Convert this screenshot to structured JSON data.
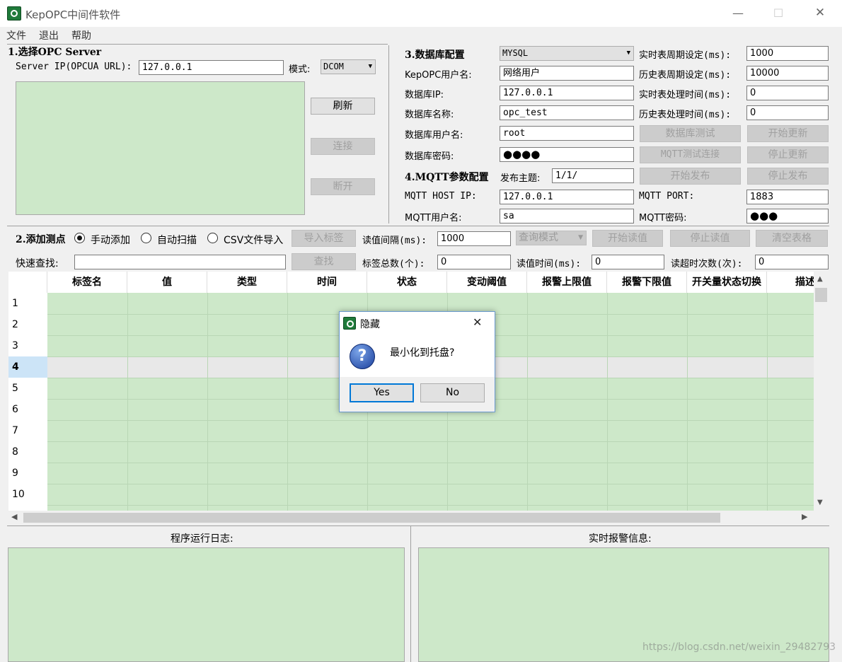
{
  "window": {
    "title": "KepOPC中间件软件",
    "min": "—",
    "max": "☐",
    "close": "✕"
  },
  "menu": [
    "文件",
    "退出",
    "帮助"
  ],
  "opc": {
    "title": "1.选择OPC Server",
    "ip_label": "Server IP(OPCUA URL):",
    "ip_value": "127.0.0.1",
    "mode_label": "模式:",
    "mode_value": "DCOM",
    "refresh": "刷新",
    "connect": "连接",
    "disconnect": "断开"
  },
  "db": {
    "title": "3.数据库配置",
    "db_type": "MYSQL",
    "user_label": "KepOPC用户名:",
    "user_value": "网络用户",
    "ip_label": "数据库IP:",
    "ip_value": "127.0.0.1",
    "name_label": "数据库名称:",
    "name_value": "opc_test",
    "dbuser_label": "数据库用户名:",
    "dbuser_value": "root",
    "pwd_label": "数据库密码:",
    "pwd_value": "●●●●",
    "rt_period_label": "实时表周期设定(ms):",
    "rt_period_value": "1000",
    "hist_period_label": "历史表周期设定(ms):",
    "hist_period_value": "10000",
    "rt_proc_label": "实时表处理时间(ms):",
    "rt_proc_value": "0",
    "hist_proc_label": "历史表处理时间(ms):",
    "hist_proc_value": "0",
    "db_test": "数据库测试",
    "start_update": "开始更新",
    "mqtt_test": "MQTT测试连接",
    "stop_update": "停止更新"
  },
  "mqtt": {
    "title": "4.MQTT参数配置",
    "topic_label": "发布主题:",
    "topic_value": "1/1/",
    "start_pub": "开始发布",
    "stop_pub": "停止发布",
    "host_label": "MQTT HOST IP:",
    "host_value": "127.0.0.1",
    "port_label": "MQTT PORT:",
    "port_value": "1883",
    "user_label": "MQTT用户名:",
    "user_value": "sa",
    "pwd_label": "MQTT密码:",
    "pwd_value": "●●●"
  },
  "points": {
    "title": "2.添加测点",
    "manual": "手动添加",
    "auto": "自动扫描",
    "csv": "CSV文件导入",
    "import": "导入标签",
    "interval_label": "读值间隔(ms):",
    "interval_value": "1000",
    "query_mode": "查询模式",
    "start_read": "开始读值",
    "stop_read": "停止读值",
    "clear": "清空表格",
    "search_label": "快速查找:",
    "search_value": "",
    "search_btn": "查找",
    "total_label": "标签总数(个):",
    "total_value": "0",
    "readtime_label": "读值时间(ms):",
    "readtime_value": "0",
    "timeout_label": "读超时次数(次):",
    "timeout_value": "0"
  },
  "table": {
    "columns": [
      "标签名",
      "值",
      "类型",
      "时间",
      "状态",
      "变动阈值",
      "报警上限值",
      "报警下限值",
      "开关量状态切换",
      "描述"
    ],
    "rows": [
      "1",
      "2",
      "3",
      "4",
      "5",
      "6",
      "7",
      "8",
      "9",
      "10"
    ],
    "selected_row": 4
  },
  "log": {
    "title": "程序运行日志:"
  },
  "alarm": {
    "title": "实时报警信息:"
  },
  "dialog": {
    "title": "隐藏",
    "message": "最小化到托盘?",
    "yes": "Yes",
    "no": "No",
    "close": "✕"
  },
  "watermark": "https://blog.csdn.net/weixin_29482793"
}
